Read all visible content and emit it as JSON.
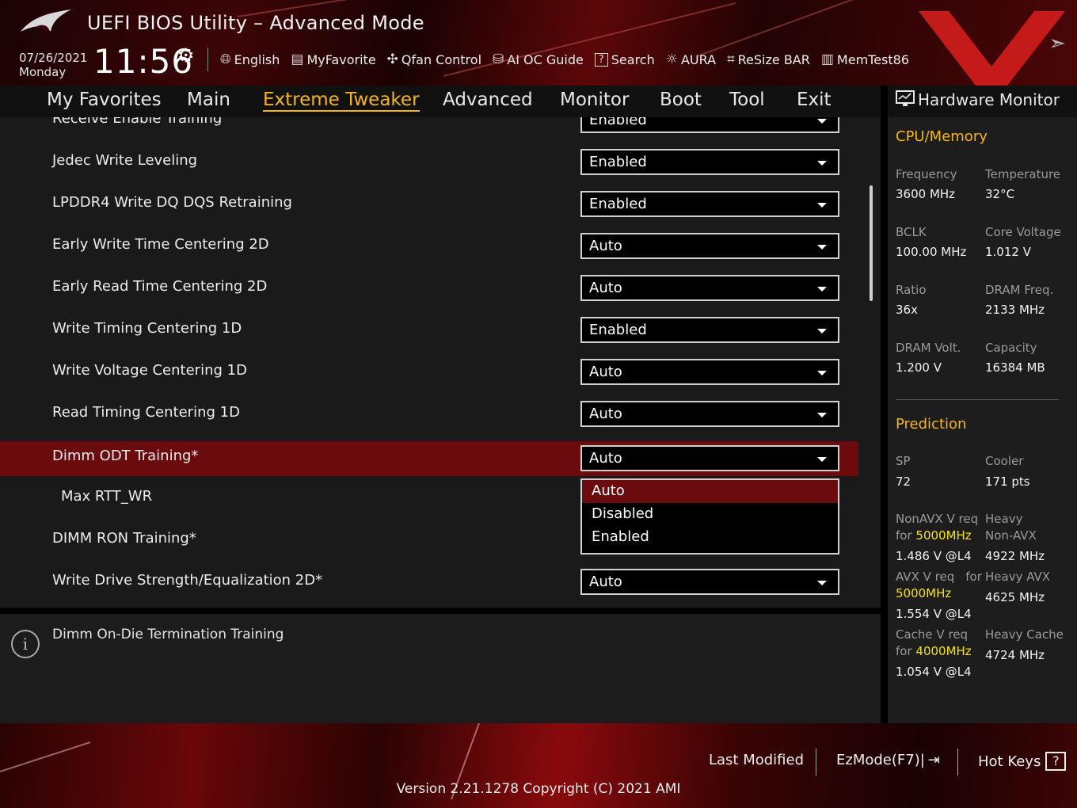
{
  "header": {
    "title": "UEFI BIOS Utility – Advanced Mode",
    "date": "07/26/2021",
    "day": "Monday",
    "time": "11:56",
    "tools": [
      {
        "icon": "globe-icon",
        "label": "English"
      },
      {
        "icon": "favorite-icon",
        "label": "MyFavorite"
      },
      {
        "icon": "fan-icon",
        "label": "Qfan Control"
      },
      {
        "icon": "ai-chip-icon",
        "label": "AI OC Guide"
      },
      {
        "icon": "help-icon",
        "label": "Search"
      },
      {
        "icon": "aura-icon",
        "label": "AURA"
      },
      {
        "icon": "resize-bar-icon",
        "label": "ReSize BAR"
      },
      {
        "icon": "memory-icon",
        "label": "MemTest86"
      }
    ]
  },
  "menu": {
    "items": [
      "My Favorites",
      "Main",
      "Extreme Tweaker",
      "Advanced",
      "Monitor",
      "Boot",
      "Tool",
      "Exit"
    ],
    "active": "Extreme Tweaker"
  },
  "settings": [
    {
      "label": "Receive Enable Training",
      "value": "Enabled"
    },
    {
      "label": "Jedec Write Leveling",
      "value": "Enabled"
    },
    {
      "label": "LPDDR4 Write DQ DQS Retraining",
      "value": "Enabled"
    },
    {
      "label": "Early Write Time Centering 2D",
      "value": "Auto"
    },
    {
      "label": "Early Read Time Centering 2D",
      "value": "Auto"
    },
    {
      "label": "Write Timing Centering 1D",
      "value": "Enabled"
    },
    {
      "label": "Write Voltage Centering 1D",
      "value": "Auto"
    },
    {
      "label": "Read Timing Centering 1D",
      "value": "Auto"
    },
    {
      "label": "Dimm ODT Training*",
      "value": "Auto",
      "highlighted": true
    },
    {
      "label": "Max RTT_WR",
      "value": "",
      "sub": true
    },
    {
      "label": "DIMM RON Training*",
      "value": ""
    },
    {
      "label": "Write Drive Strength/Equalization 2D*",
      "value": "Auto"
    }
  ],
  "dropdown_popup": {
    "options": [
      "Auto",
      "Disabled",
      "Enabled"
    ],
    "selected": "Auto"
  },
  "help": {
    "text": "Dimm On-Die Termination Training"
  },
  "hardware_monitor": {
    "title": "Hardware Monitor",
    "cpu_memory": {
      "title": "CPU/Memory",
      "items": [
        {
          "label": "Frequency",
          "value": "3600 MHz"
        },
        {
          "label": "Temperature",
          "value": "32°C"
        },
        {
          "label": "BCLK",
          "value": "100.00 MHz"
        },
        {
          "label": "Core Voltage",
          "value": "1.012 V"
        },
        {
          "label": "Ratio",
          "value": "36x"
        },
        {
          "label": "DRAM Freq.",
          "value": "2133 MHz"
        },
        {
          "label": "DRAM Volt.",
          "value": "1.200 V"
        },
        {
          "label": "Capacity",
          "value": "16384 MB"
        }
      ]
    },
    "prediction": {
      "title": "Prediction",
      "sp_label": "SP",
      "sp_value": "72",
      "cooler_label": "Cooler",
      "cooler_value": "171 pts",
      "nonavx_label": "NonAVX V req",
      "nonavx_for": "for",
      "nonavx_freq": "5000MHz",
      "nonavx_value": "1.486 V @L4",
      "heavy_nonavx_label1": "Heavy",
      "heavy_nonavx_label2": "Non-AVX",
      "heavy_nonavx_value": "4922 MHz",
      "avx_label": "AVX V req",
      "avx_for": "for",
      "avx_freq": "5000MHz",
      "avx_value": "1.554 V @L4",
      "heavy_avx_label": "Heavy AVX",
      "heavy_avx_value": "4625 MHz",
      "cache_label": "Cache V req",
      "cache_for": "for",
      "cache_freq": "4000MHz",
      "cache_value": "1.054 V @L4",
      "heavy_cache_label": "Heavy Cache",
      "heavy_cache_value": "4724 MHz"
    }
  },
  "footer": {
    "last_modified": "Last Modified",
    "ezmode": "EzMode(F7)|",
    "hotkeys": "Hot Keys",
    "hotkeys_glyph": "?",
    "version": "Version 2.21.1278 Copyright (C) 2021 AMI"
  },
  "colors": {
    "accent": "#f5b417",
    "highlight_row": "#6b0b0d",
    "prediction_freq": "#f5e40a"
  }
}
